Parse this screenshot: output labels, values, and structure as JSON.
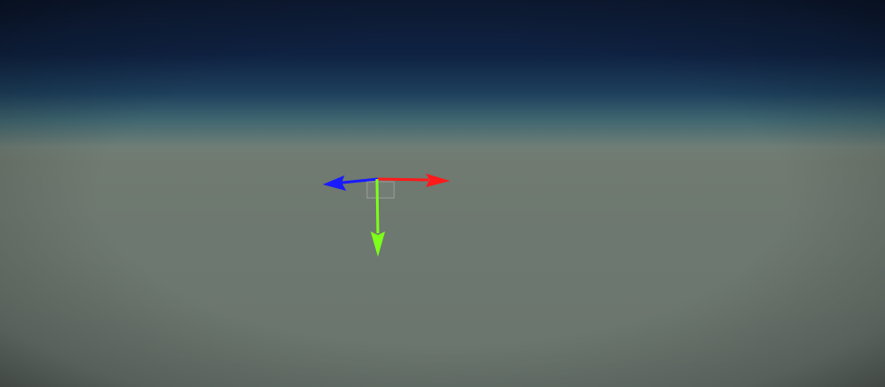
{
  "scene": {
    "type": "3d-viewport",
    "sky_colors": [
      "#0d1a33",
      "#1d3f5c",
      "#6f7e76"
    ],
    "ground_color": "#6b7670"
  },
  "gizmo": {
    "type": "move-transform-gizmo",
    "axes": [
      {
        "name": "x-axis",
        "color": "#ff1a1a",
        "direction": "right"
      },
      {
        "name": "y-axis",
        "color": "#7dff1a",
        "direction": "down"
      },
      {
        "name": "z-axis",
        "color": "#1a1aff",
        "direction": "left"
      }
    ],
    "center_handle_color": "#9a9a9a"
  }
}
